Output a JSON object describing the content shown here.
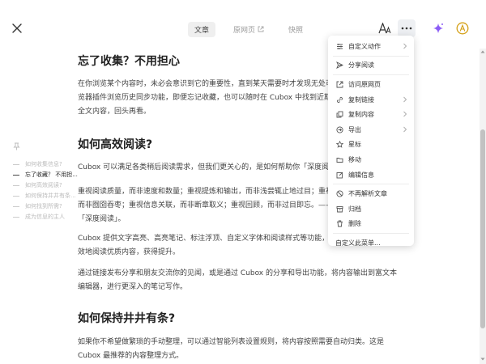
{
  "header": {
    "tabs": [
      {
        "label": "文章",
        "active": true
      },
      {
        "label": "原网页",
        "active": false
      },
      {
        "label": "快照",
        "active": false
      }
    ],
    "icons": {
      "close": "close-icon",
      "font": "font-settings-icon",
      "more": "more-icon",
      "ai": "sparkle-icon",
      "ai_color": "#8b5cf6",
      "profile": "circle-a-icon",
      "profile_color": "#d4a017"
    }
  },
  "outline": {
    "items": [
      {
        "label": "如何收集信息?",
        "active": false
      },
      {
        "label": "忘了收藏？ 不用担...",
        "active": true
      },
      {
        "label": "如何高效阅读?",
        "active": false
      },
      {
        "label": "如何保持井井有条...",
        "active": false
      },
      {
        "label": "如何找到所需?",
        "active": false
      },
      {
        "label": "成为信息的主人",
        "active": false
      }
    ]
  },
  "article": {
    "h1": "忘了收集？不用担心",
    "p1": "在你浏览某个内容时，未必会意识到它的重要性，直到某天需要时才发现无处可寻。借助 Cubox 浏览器插件浏览历史同步功能，即便忘记收藏，也可以随时在 Cubox 中找到近期浏览过的网页链接与全文内容，回头再看。",
    "h2": "如何高效阅读?",
    "p2": "Cubox 可以满足各类稍后阅读需求，但我们更关心的，是如何帮助你「深度阅读」。",
    "p3": "重视阅读质量，而非速度和数量；重视提炼和输出，而非浅尝辄止地过目；重视思考、理解和批判，而非囫囵吞枣；重视信息关联，而非断章取义；重视回顾，而非过目即忘。—— 这是我们所理解的「深度阅读」。",
    "p4": "Cubox 提供文字高亮、高亮笔记、标注浮顶、自定义字体和阅读样式等功能，帮助你更专注、更高效地阅读优质内容，获得提升。",
    "p5": "通过链接发布分享和朋友交流你的见闻，或是通过 Cubox 的分享和导出功能，将内容输出到富文本编辑器，进行更深入的笔记写作。",
    "h3": "如何保持井井有条?",
    "p6": "如果你不希望做繁琐的手动整理，可以通过智能列表设置规则，将内容按照需要自动归类。这是 Cubox 最推荐的内容整理方式。"
  },
  "menu": {
    "items": [
      {
        "label": "自定义动作",
        "icon": "custom-action-icon",
        "submenu": true
      },
      {
        "label": "分享阅读",
        "icon": "share-icon",
        "submenu": false
      },
      {
        "label": "访问原网页",
        "icon": "open-link-icon",
        "submenu": false
      },
      {
        "label": "复制链接",
        "icon": "copy-link-icon",
        "submenu": true
      },
      {
        "label": "复制内容",
        "icon": "copy-content-icon",
        "submenu": true
      },
      {
        "label": "导出",
        "icon": "export-icon",
        "submenu": true
      },
      {
        "label": "星标",
        "icon": "star-icon",
        "submenu": false
      },
      {
        "label": "移动",
        "icon": "move-icon",
        "submenu": false
      },
      {
        "label": "编辑信息",
        "icon": "edit-icon",
        "submenu": false
      },
      {
        "label": "不再解析文章",
        "icon": "no-parse-icon",
        "submenu": false
      },
      {
        "label": "归档",
        "icon": "archive-icon",
        "submenu": false
      },
      {
        "label": "删除",
        "icon": "trash-icon",
        "submenu": false
      },
      {
        "label": "自定义此菜单...",
        "icon": "",
        "submenu": false
      }
    ]
  }
}
